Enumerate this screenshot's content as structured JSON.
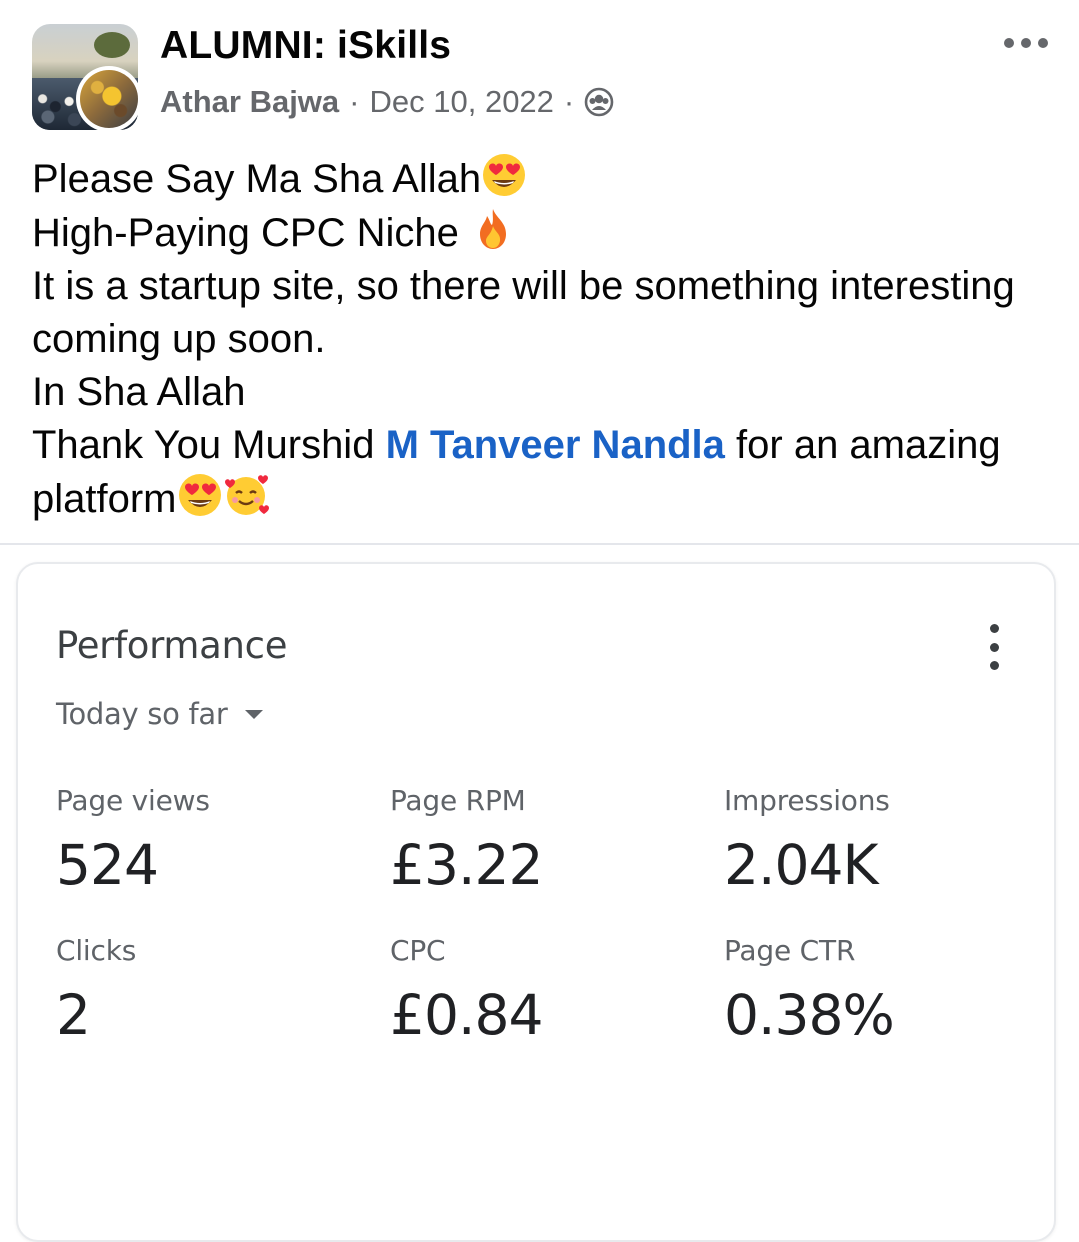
{
  "post": {
    "group_name": "ALUMNI: iSkills",
    "author": "Athar Bajwa",
    "separator": "·",
    "date": "Dec 10, 2022",
    "privacy_icon": "group-privacy-icon",
    "more_icon": "more-options-icon",
    "text_lines": [
      "Please Say Ma Sha Allah",
      "High-Paying CPC Niche ",
      "It is a startup site, so there will be something interesting coming up soon.",
      "In Sha Allah"
    ],
    "thanks_prefix": "Thank You Murshid ",
    "mention": "M Tanveer Nandla",
    "thanks_suffix": " for an amazing platform",
    "emojis": [
      "heart-eyes-emoji",
      "fire-emoji",
      "heart-eyes-emoji",
      "smiling-face-with-hearts-emoji"
    ],
    "mention_color": "#1a62c6"
  },
  "performance_card": {
    "title": "Performance",
    "range": "Today so far",
    "menu_icon": "vertical-more-icon",
    "metrics": [
      {
        "label": "Page views",
        "value": "524"
      },
      {
        "label": "Page RPM",
        "value": "£3.22"
      },
      {
        "label": "Impressions",
        "value": "2.04K"
      },
      {
        "label": "Clicks",
        "value": "2"
      },
      {
        "label": "CPC",
        "value": "£0.84"
      },
      {
        "label": "Page CTR",
        "value": "0.38%"
      }
    ]
  }
}
